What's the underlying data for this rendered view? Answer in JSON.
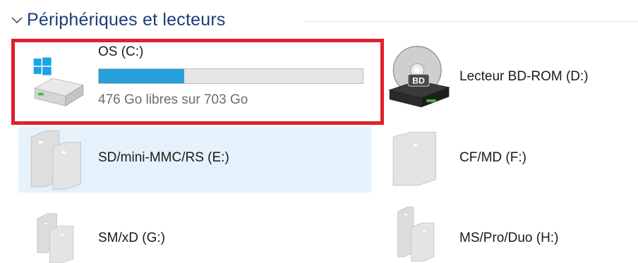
{
  "group": {
    "title": "Périphériques et lecteurs"
  },
  "drives": [
    {
      "name": "OS (C:)",
      "free_text": "476 Go libres sur 703 Go",
      "used_fraction": 0.323,
      "icon": "windows-hard-drive-icon"
    },
    {
      "name": "Lecteur BD-ROM (D:)",
      "icon": "bd-rom-drive-icon",
      "disc_label": "BD"
    },
    {
      "name": "SD/mini-MMC/RS (E:)",
      "icon": "sd-card-drive-icon",
      "selected": true
    },
    {
      "name": "CF/MD (F:)",
      "icon": "cf-card-drive-icon"
    },
    {
      "name": "SM/xD (G:)",
      "icon": "sm-card-drive-icon"
    },
    {
      "name": "MS/Pro/Duo (H:)",
      "icon": "ms-card-drive-icon"
    }
  ],
  "colors": {
    "header": "#1e3c78",
    "bar_fill": "#26a0da",
    "selection": "#e5f1fb",
    "annotation": "#e0202a"
  }
}
